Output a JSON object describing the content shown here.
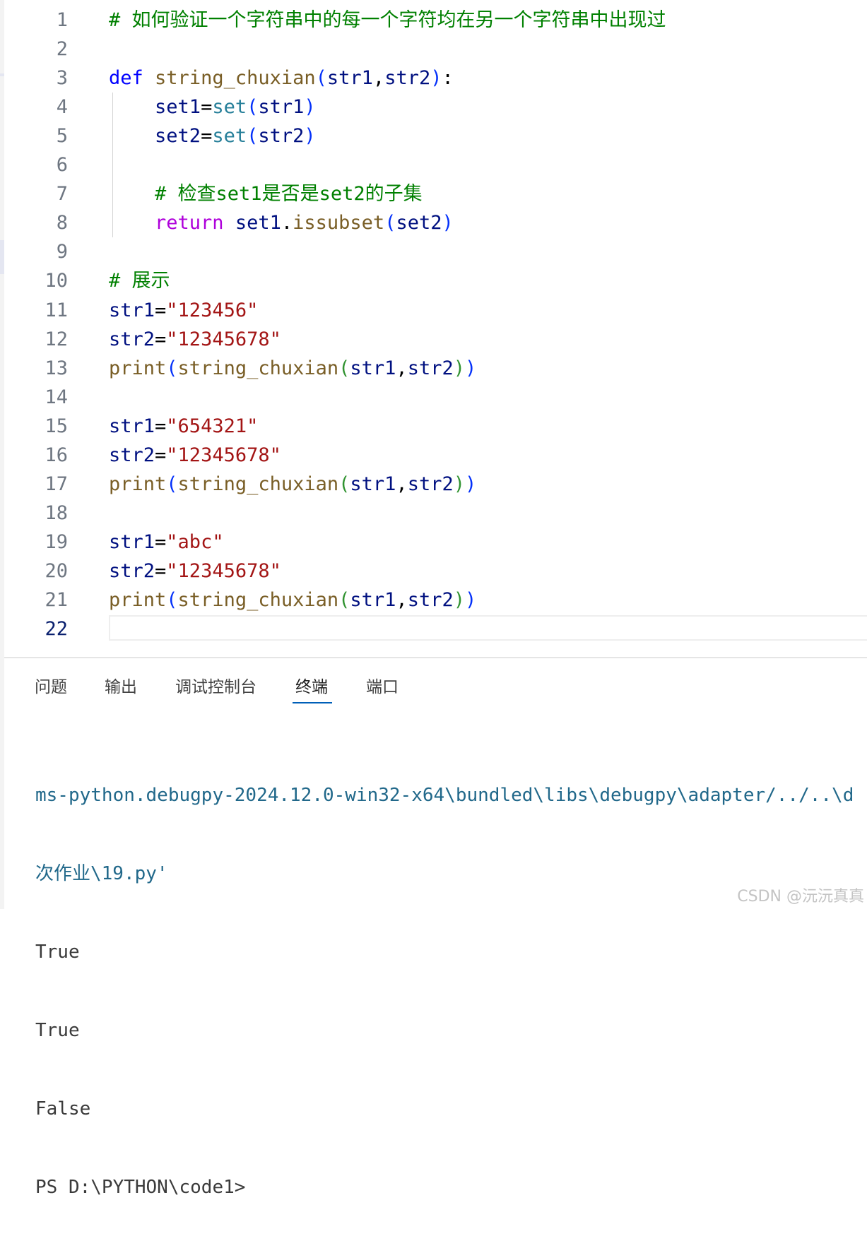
{
  "editor": {
    "active_line": 22,
    "lines": [
      {
        "n": "1",
        "tokens": [
          {
            "t": "# 如何验证一个字符串中的每一个字符均在另一个字符串中出现过",
            "c": "comment"
          }
        ]
      },
      {
        "n": "2",
        "tokens": []
      },
      {
        "n": "3",
        "tokens": [
          {
            "t": "def",
            "c": "kw"
          },
          {
            "t": " ",
            "c": "op"
          },
          {
            "t": "string_chuxian",
            "c": "fn"
          },
          {
            "t": "(",
            "c": "b1"
          },
          {
            "t": "str1",
            "c": "var"
          },
          {
            "t": ",",
            "c": "op"
          },
          {
            "t": "str2",
            "c": "var"
          },
          {
            "t": ")",
            "c": "b1"
          },
          {
            "t": ":",
            "c": "op"
          }
        ]
      },
      {
        "n": "4",
        "tokens": [
          {
            "t": "    ",
            "c": "op"
          },
          {
            "t": "set1",
            "c": "var"
          },
          {
            "t": "=",
            "c": "op"
          },
          {
            "t": "set",
            "c": "type"
          },
          {
            "t": "(",
            "c": "b1"
          },
          {
            "t": "str1",
            "c": "var"
          },
          {
            "t": ")",
            "c": "b1"
          }
        ]
      },
      {
        "n": "5",
        "tokens": [
          {
            "t": "    ",
            "c": "op"
          },
          {
            "t": "set2",
            "c": "var"
          },
          {
            "t": "=",
            "c": "op"
          },
          {
            "t": "set",
            "c": "type"
          },
          {
            "t": "(",
            "c": "b1"
          },
          {
            "t": "str2",
            "c": "var"
          },
          {
            "t": ")",
            "c": "b1"
          }
        ]
      },
      {
        "n": "6",
        "tokens": []
      },
      {
        "n": "7",
        "tokens": [
          {
            "t": "    ",
            "c": "op"
          },
          {
            "t": "# 检查set1是否是set2的子集",
            "c": "comment"
          }
        ]
      },
      {
        "n": "8",
        "tokens": [
          {
            "t": "    ",
            "c": "op"
          },
          {
            "t": "return",
            "c": "ctrl"
          },
          {
            "t": " ",
            "c": "op"
          },
          {
            "t": "set1",
            "c": "var"
          },
          {
            "t": ".",
            "c": "op"
          },
          {
            "t": "issubset",
            "c": "fn"
          },
          {
            "t": "(",
            "c": "b1"
          },
          {
            "t": "set2",
            "c": "var"
          },
          {
            "t": ")",
            "c": "b1"
          }
        ]
      },
      {
        "n": "9",
        "tokens": []
      },
      {
        "n": "10",
        "tokens": [
          {
            "t": "# 展示",
            "c": "comment"
          }
        ]
      },
      {
        "n": "11",
        "tokens": [
          {
            "t": "str1",
            "c": "var"
          },
          {
            "t": "=",
            "c": "op"
          },
          {
            "t": "\"123456\"",
            "c": "str"
          }
        ]
      },
      {
        "n": "12",
        "tokens": [
          {
            "t": "str2",
            "c": "var"
          },
          {
            "t": "=",
            "c": "op"
          },
          {
            "t": "\"12345678\"",
            "c": "str"
          }
        ]
      },
      {
        "n": "13",
        "tokens": [
          {
            "t": "print",
            "c": "fn"
          },
          {
            "t": "(",
            "c": "b1"
          },
          {
            "t": "string_chuxian",
            "c": "fn"
          },
          {
            "t": "(",
            "c": "b2"
          },
          {
            "t": "str1",
            "c": "var"
          },
          {
            "t": ",",
            "c": "op"
          },
          {
            "t": "str2",
            "c": "var"
          },
          {
            "t": ")",
            "c": "b2"
          },
          {
            "t": ")",
            "c": "b1"
          }
        ]
      },
      {
        "n": "14",
        "tokens": []
      },
      {
        "n": "15",
        "tokens": [
          {
            "t": "str1",
            "c": "var"
          },
          {
            "t": "=",
            "c": "op"
          },
          {
            "t": "\"654321\"",
            "c": "str"
          }
        ]
      },
      {
        "n": "16",
        "tokens": [
          {
            "t": "str2",
            "c": "var"
          },
          {
            "t": "=",
            "c": "op"
          },
          {
            "t": "\"12345678\"",
            "c": "str"
          }
        ]
      },
      {
        "n": "17",
        "tokens": [
          {
            "t": "print",
            "c": "fn"
          },
          {
            "t": "(",
            "c": "b1"
          },
          {
            "t": "string_chuxian",
            "c": "fn"
          },
          {
            "t": "(",
            "c": "b2"
          },
          {
            "t": "str1",
            "c": "var"
          },
          {
            "t": ",",
            "c": "op"
          },
          {
            "t": "str2",
            "c": "var"
          },
          {
            "t": ")",
            "c": "b2"
          },
          {
            "t": ")",
            "c": "b1"
          }
        ]
      },
      {
        "n": "18",
        "tokens": []
      },
      {
        "n": "19",
        "tokens": [
          {
            "t": "str1",
            "c": "var"
          },
          {
            "t": "=",
            "c": "op"
          },
          {
            "t": "\"abc\"",
            "c": "str"
          }
        ]
      },
      {
        "n": "20",
        "tokens": [
          {
            "t": "str2",
            "c": "var"
          },
          {
            "t": "=",
            "c": "op"
          },
          {
            "t": "\"12345678\"",
            "c": "str"
          }
        ]
      },
      {
        "n": "21",
        "tokens": [
          {
            "t": "print",
            "c": "fn"
          },
          {
            "t": "(",
            "c": "b1"
          },
          {
            "t": "string_chuxian",
            "c": "fn"
          },
          {
            "t": "(",
            "c": "b2"
          },
          {
            "t": "str1",
            "c": "var"
          },
          {
            "t": ",",
            "c": "op"
          },
          {
            "t": "str2",
            "c": "var"
          },
          {
            "t": ")",
            "c": "b2"
          },
          {
            "t": ")",
            "c": "b1"
          }
        ]
      },
      {
        "n": "22",
        "tokens": []
      }
    ]
  },
  "panel": {
    "tabs": [
      {
        "label": "问题",
        "active": false
      },
      {
        "label": "输出",
        "active": false
      },
      {
        "label": "调试控制台",
        "active": false
      },
      {
        "label": "终端",
        "active": true
      },
      {
        "label": "端口",
        "active": false
      }
    ],
    "terminal": {
      "path_line_1": "ms-python.debugpy-2024.12.0-win32-x64\\bundled\\libs\\debugpy\\adapter/../..\\d",
      "path_line_2": "次作业\\19.py'",
      "outputs": [
        "True",
        "True",
        "False"
      ],
      "prompt": "PS D:\\PYTHON\\code1>"
    }
  },
  "watermark": "CSDN @沅沅真真"
}
